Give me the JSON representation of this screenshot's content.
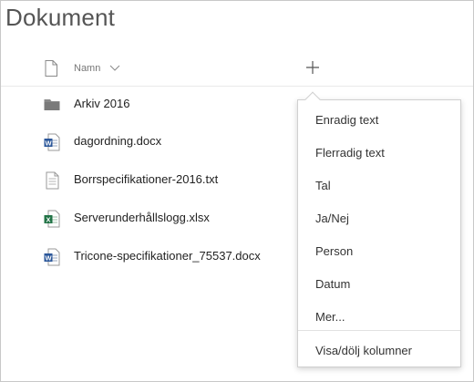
{
  "page": {
    "title": "Dokument"
  },
  "header": {
    "name_label": "Namn"
  },
  "files": [
    {
      "name": "Arkiv 2016",
      "icon": "folder-icon"
    },
    {
      "name": "dagordning.docx",
      "icon": "word-doc-icon"
    },
    {
      "name": "Borrspecifikationer-2016.txt",
      "icon": "text-file-icon"
    },
    {
      "name": "Serverunderhållslogg.xlsx",
      "icon": "excel-file-icon"
    },
    {
      "name": "Tricone-specifikationer_75537.docx",
      "icon": "word-doc-icon"
    }
  ],
  "add_column_menu": {
    "items": [
      "Enradig text",
      "Flerradig text",
      "Tal",
      "Ja/Nej",
      "Person",
      "Datum",
      "Mer..."
    ],
    "footer_item": "Visa/dölj kolumner"
  },
  "colors": {
    "word_blue": "#2b579a",
    "excel_green": "#217346",
    "folder_grey": "#8a8a8a"
  }
}
